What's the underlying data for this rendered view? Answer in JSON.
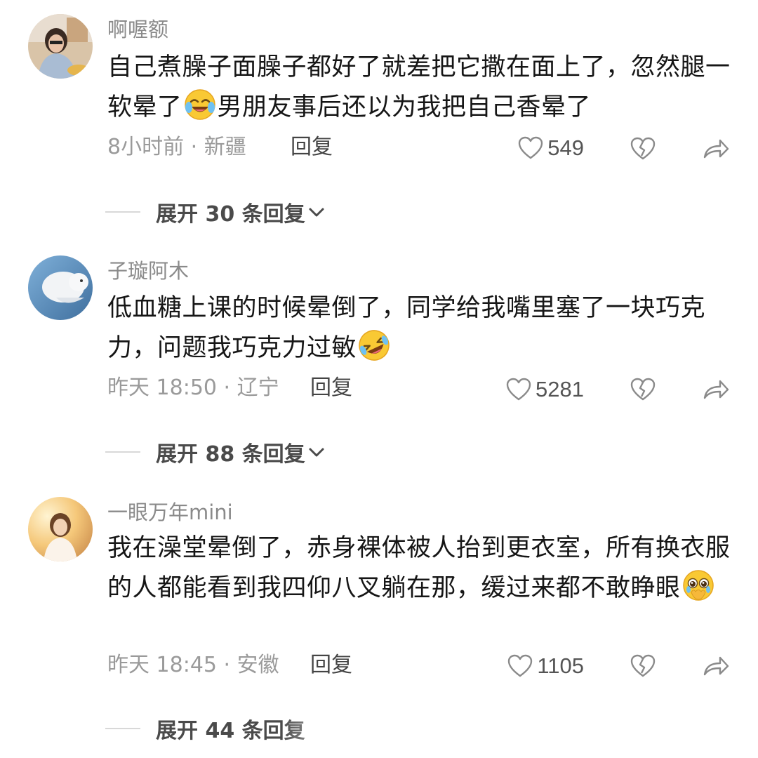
{
  "comments": [
    {
      "username": "啊喔额",
      "content_before_emoji": "自己煮臊子面臊子都好了就差把它撒在面上了，忽然腿一软晕了",
      "emoji_1": "crying-laughing-emoji",
      "content_after_emoji": "男朋友事后还以为我把自己香晕了",
      "meta": "8小时前 · 新疆",
      "reply_label": "回复",
      "likes": "549",
      "expand_label": "展开 30 条回复"
    },
    {
      "username": "子璇阿木",
      "content_before_emoji": "低血糖上课的时候晕倒了，同学给我嘴里塞了一块巧克力，问题我巧克力过敏",
      "emoji_1": "rolling-laughing-emoji",
      "content_after_emoji": "",
      "meta": "昨天 18:50 · 辽宁",
      "reply_label": "回复",
      "likes": "5281",
      "expand_label": "展开 88 条回复"
    },
    {
      "username": "一眼万年mini",
      "content_before_emoji": "我在澡堂晕倒了，赤身裸体被人抬到更衣室，所有换衣服的人都能看到我四仰八叉躺在那，缓过来都不敢睁眼",
      "emoji_1": "pleading-face-emoji",
      "content_after_emoji": "",
      "meta": "昨天 18:45 · 安徽",
      "reply_label": "回复",
      "likes": "1105",
      "expand_label": "展开 44 条回复"
    }
  ],
  "colors": {
    "text": "#161616",
    "muted": "#9a9a9a",
    "icon": "#8a8a8a"
  }
}
